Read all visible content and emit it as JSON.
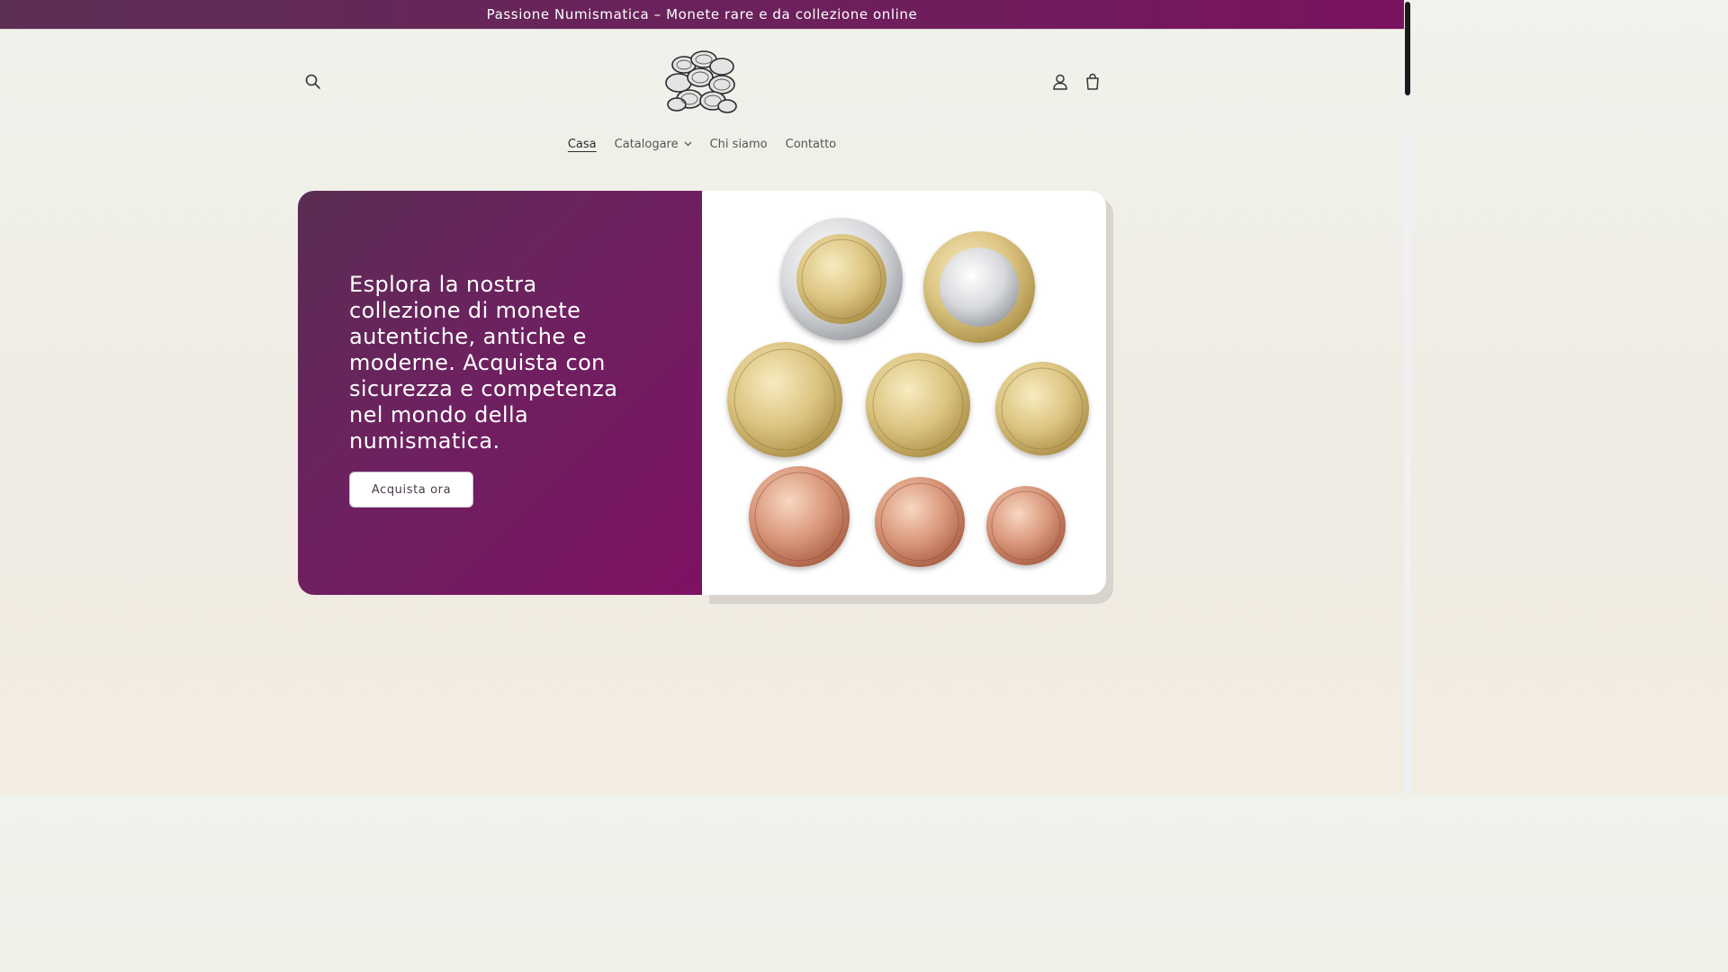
{
  "announcement": {
    "text": "Passione Numismatica – Monete rare e da collezione online"
  },
  "header": {
    "search_icon": "search-icon",
    "account_icon": "user-icon",
    "cart_icon": "cart-icon",
    "logo_icon": "coins-logo"
  },
  "nav": {
    "items": [
      {
        "label": "Casa",
        "active": true
      },
      {
        "label": "Catalogare",
        "has_dropdown": true
      },
      {
        "label": "Chi siamo"
      },
      {
        "label": "Contatto"
      }
    ]
  },
  "hero": {
    "heading": "Esplora la nostra collezione di monete autentiche, antiche e moderne. Acquista con sicurezza e competenza nel mondo della numismatica.",
    "cta_label": "Acquista ora",
    "image_icon": "euro-coins-image"
  },
  "colors": {
    "brand_purple": "#6d2160",
    "brand_magenta": "#7e1163",
    "background": "#f1efe8"
  }
}
